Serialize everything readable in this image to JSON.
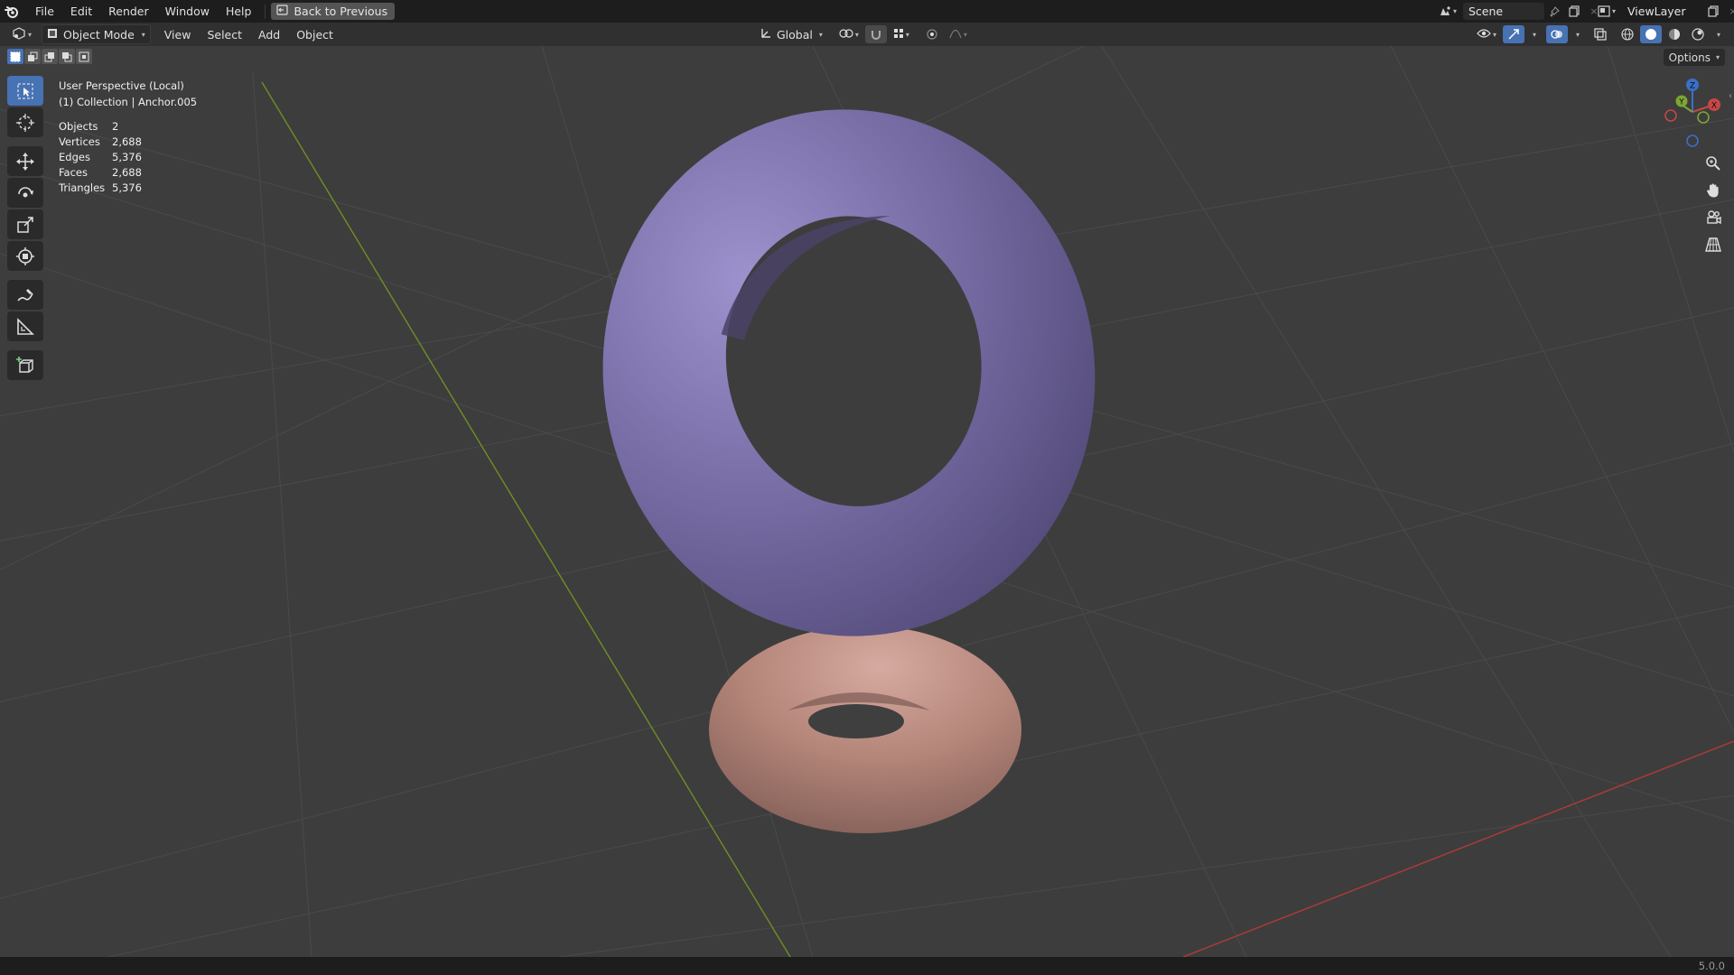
{
  "menu": {
    "items": [
      "File",
      "Edit",
      "Render",
      "Window",
      "Help"
    ],
    "back_button": "Back to Previous"
  },
  "scene": {
    "label": "Scene"
  },
  "view_layer": {
    "label": "ViewLayer"
  },
  "header": {
    "mode": "Object Mode",
    "menus": [
      "View",
      "Select",
      "Add",
      "Object"
    ],
    "orientation": "Global",
    "options_label": "Options"
  },
  "overlay": {
    "perspective": "User Perspective (Local)",
    "collection_line": "(1) Collection | Anchor.005",
    "stats": [
      {
        "label": "Objects",
        "value": "2"
      },
      {
        "label": "Vertices",
        "value": "2,688"
      },
      {
        "label": "Edges",
        "value": "5,376"
      },
      {
        "label": "Faces",
        "value": "2,688"
      },
      {
        "label": "Triangles",
        "value": "5,376"
      }
    ]
  },
  "gizmo": {
    "z": "Z",
    "y": "Y",
    "x": "X"
  },
  "status": {
    "version": "5.0.0"
  },
  "colors": {
    "accent": "#4772b3",
    "torus_purple": "#7b6fa8",
    "torus_pink": "#b8897f",
    "x_axis": "#b33a3a",
    "y_axis": "#6e8f24"
  }
}
